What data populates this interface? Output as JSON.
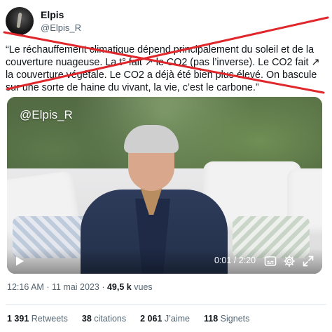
{
  "author": {
    "display_name": "Elpis",
    "handle": "@Elpis_R"
  },
  "tweet": {
    "text": "“Le réchauffement climatique dépend principalement du soleil et de la couverture nuageuse. La t° fait ↗ le CO2 (pas l’inverse). Le CO2 fait ↗ la couverture végétale. Le CO2 a déjà été bien plus élevé. On bascule sur une sorte de haine du vivant, la vie, c’est le carbone.”"
  },
  "video": {
    "watermark": "@Elpis_R",
    "time_current": "0:01",
    "time_total": "2:20",
    "time_display": "0:01 / 2:20",
    "progress_fraction": 0.007
  },
  "meta": {
    "time": "12:16 AM",
    "separator": "·",
    "date": "11 mai 2023",
    "views_count": "49,5 k",
    "views_label": "vues"
  },
  "stats": {
    "retweets_count": "1 391",
    "retweets_label": "Retweets",
    "quotes_count": "38",
    "quotes_label": "citations",
    "likes_count": "2 061",
    "likes_label": "J’aime",
    "bookmarks_count": "118",
    "bookmarks_label": "Signets"
  },
  "colors": {
    "cross_red": "#e0272b",
    "secondary_text": "#536471",
    "primary_text": "#0f1419"
  },
  "icons": {
    "play": "play-icon",
    "captions": "captions-icon",
    "settings": "gear-icon",
    "fullscreen": "fullscreen-icon"
  }
}
